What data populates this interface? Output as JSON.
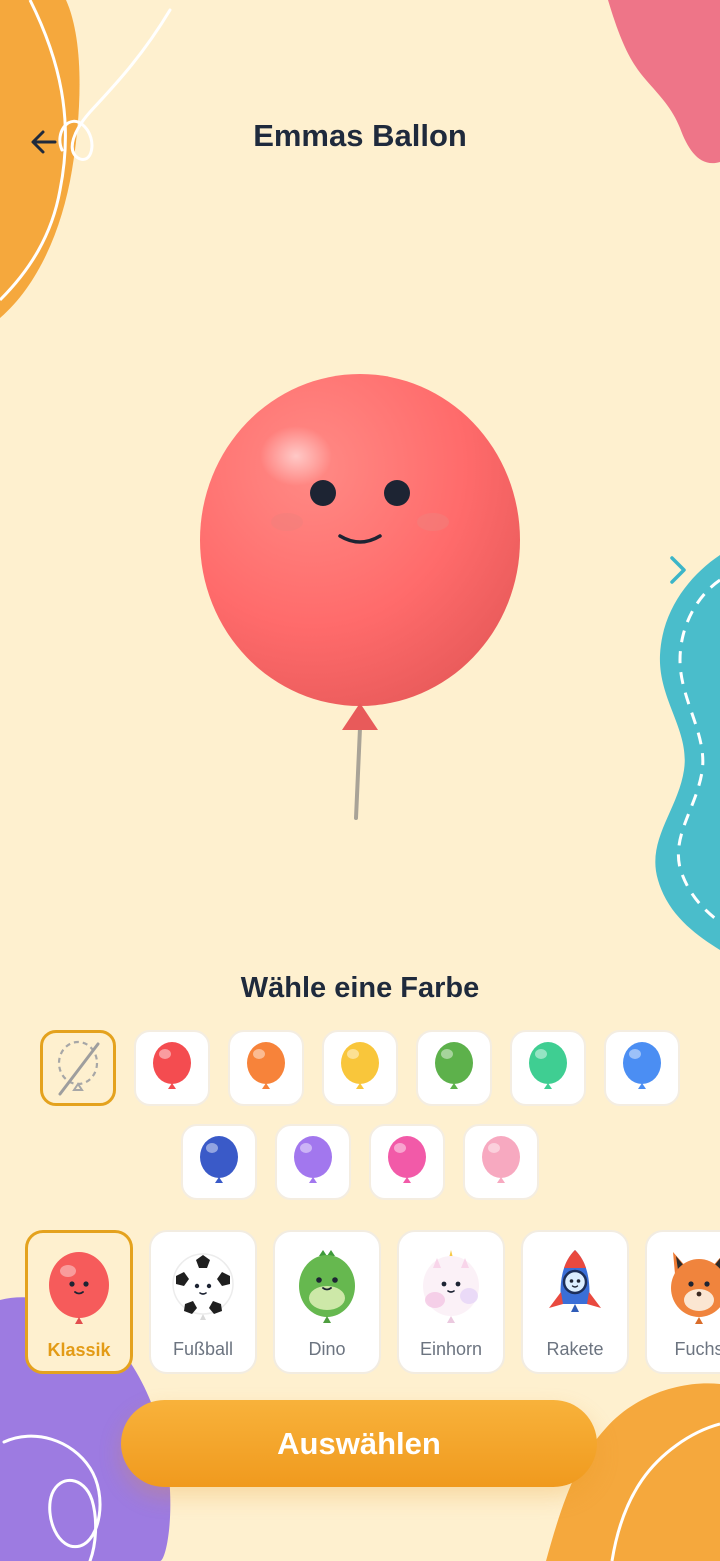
{
  "header": {
    "title": "Emmas Ballon"
  },
  "icons": {
    "back": "arrow-left-icon",
    "next": "chevron-right-icon",
    "none": "no-balloon-icon"
  },
  "color_section": {
    "title": "Wähle eine Farbe",
    "selected": "none",
    "swatches": [
      {
        "id": "none",
        "color": "none"
      },
      {
        "id": "red",
        "color": "#F44C50"
      },
      {
        "id": "orange",
        "color": "#F7833A"
      },
      {
        "id": "yellow",
        "color": "#F9C63B"
      },
      {
        "id": "green",
        "color": "#5DB14B"
      },
      {
        "id": "teal",
        "color": "#3FCE92"
      },
      {
        "id": "blue",
        "color": "#4B8EF3"
      },
      {
        "id": "navy",
        "color": "#3A5AC8"
      },
      {
        "id": "purple",
        "color": "#A277EE"
      },
      {
        "id": "pink",
        "color": "#F25AA8"
      },
      {
        "id": "light-pink",
        "color": "#F7A9C0"
      }
    ]
  },
  "styles": {
    "selected": "Klassik",
    "items": [
      {
        "label": "Klassik",
        "icon": "classic-balloon-icon"
      },
      {
        "label": "Fußball",
        "icon": "soccer-ball-icon"
      },
      {
        "label": "Dino",
        "icon": "dino-icon"
      },
      {
        "label": "Einhorn",
        "icon": "unicorn-icon"
      },
      {
        "label": "Rakete",
        "icon": "rocket-icon"
      },
      {
        "label": "Fuchs",
        "icon": "fox-icon"
      }
    ]
  },
  "preview": {
    "balloon_color": "#FF6B6B",
    "style": "classic-balloon-icon"
  },
  "actions": {
    "confirm_label": "Auswählen"
  },
  "theme": {
    "background": "#FEF0CF",
    "accent": "#F5A623",
    "title_color": "#1F2A3C"
  }
}
